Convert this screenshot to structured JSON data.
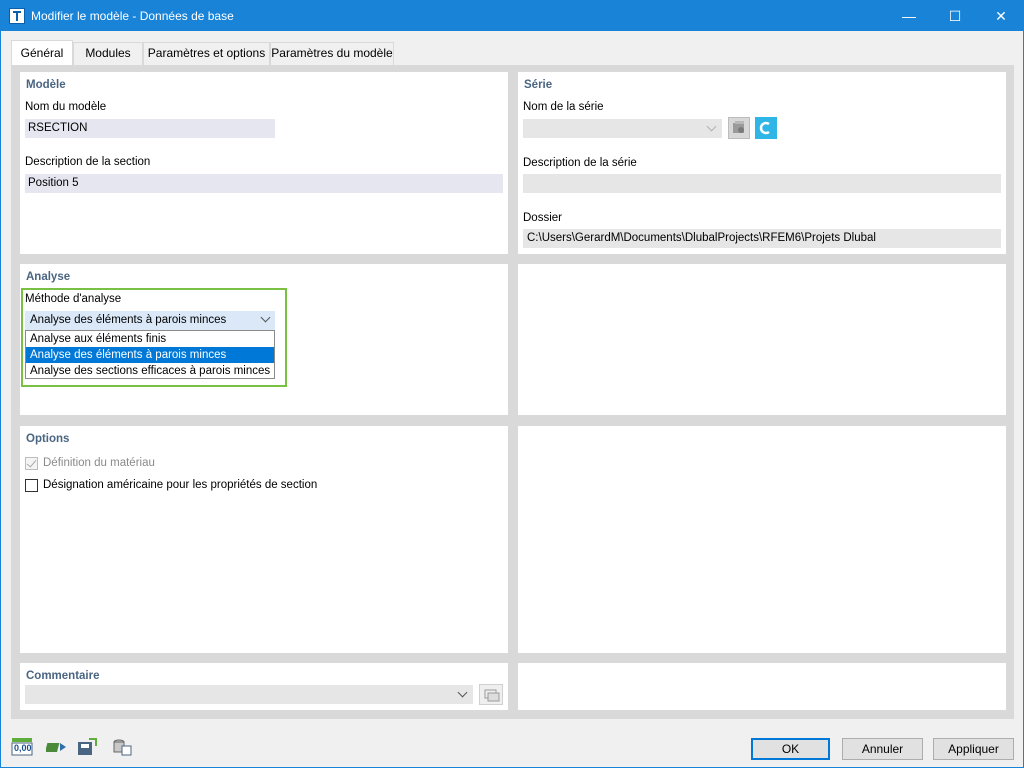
{
  "window": {
    "title": "Modifier le modèle - Données de base",
    "minimize": "—",
    "maximize": "☐",
    "close": "✕"
  },
  "tabs": [
    {
      "label": "Général",
      "active": true
    },
    {
      "label": "Modules"
    },
    {
      "label": "Paramètres et options"
    },
    {
      "label": "Paramètres du modèle"
    }
  ],
  "modele": {
    "title": "Modèle",
    "name_label": "Nom du modèle",
    "name_value": "RSECTION",
    "desc_label": "Description de la section",
    "desc_value": "Position 5"
  },
  "serie": {
    "title": "Série",
    "name_label": "Nom de la série",
    "name_value": "",
    "desc_label": "Description de la série",
    "desc_value": "",
    "folder_label": "Dossier",
    "folder_value": "C:\\Users\\GerardM\\Documents\\DlubalProjects\\RFEM6\\Projets Dlubal"
  },
  "analyse": {
    "title": "Analyse",
    "method_label": "Méthode d'analyse",
    "selected": "Analyse des éléments à parois minces",
    "options": [
      "Analyse aux éléments finis",
      "Analyse des éléments à parois minces",
      "Analyse des sections efficaces à parois minces"
    ],
    "selected_index": 1
  },
  "options": {
    "title": "Options",
    "material_def": {
      "label": "Définition du matériau",
      "checked": true,
      "disabled": true
    },
    "american": {
      "label": "Désignation américaine pour les propriétés de section",
      "checked": false
    }
  },
  "commentaire": {
    "title": "Commentaire",
    "value": ""
  },
  "footer": {
    "ok": "OK",
    "cancel": "Annuler",
    "apply": "Appliquer",
    "units_icon_text": "0,00"
  },
  "colors": {
    "titlebar": "#1883d7",
    "section_title": "#4a6582",
    "highlight": "#7ac143",
    "selection": "#0078d7"
  }
}
